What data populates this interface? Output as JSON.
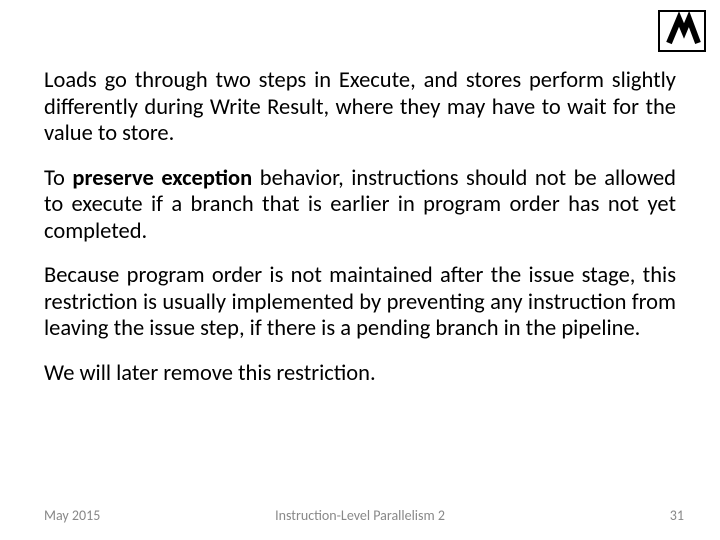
{
  "logo": {
    "name": "institution-logo"
  },
  "paragraphs": {
    "p1_a": "Loads go through two steps in Execute, and stores perform slightly differently during Write Result, where they may have to wait for the value to store.",
    "p2_a": "To ",
    "p2_b": "preserve exception",
    "p2_c": " behavior, instructions should not be allowed to execute if a branch that is earlier in program order has not yet completed.",
    "p3_a": "Because program order is not maintained after the issue stage, this restriction is usually implemented by preventing any instruction from leaving the issue step, if there is a pending branch in the pipeline.",
    "p4_a": "We will later remove this restriction."
  },
  "footer": {
    "date": "May 2015",
    "title": "Instruction-Level Parallelism 2",
    "page": "31"
  }
}
